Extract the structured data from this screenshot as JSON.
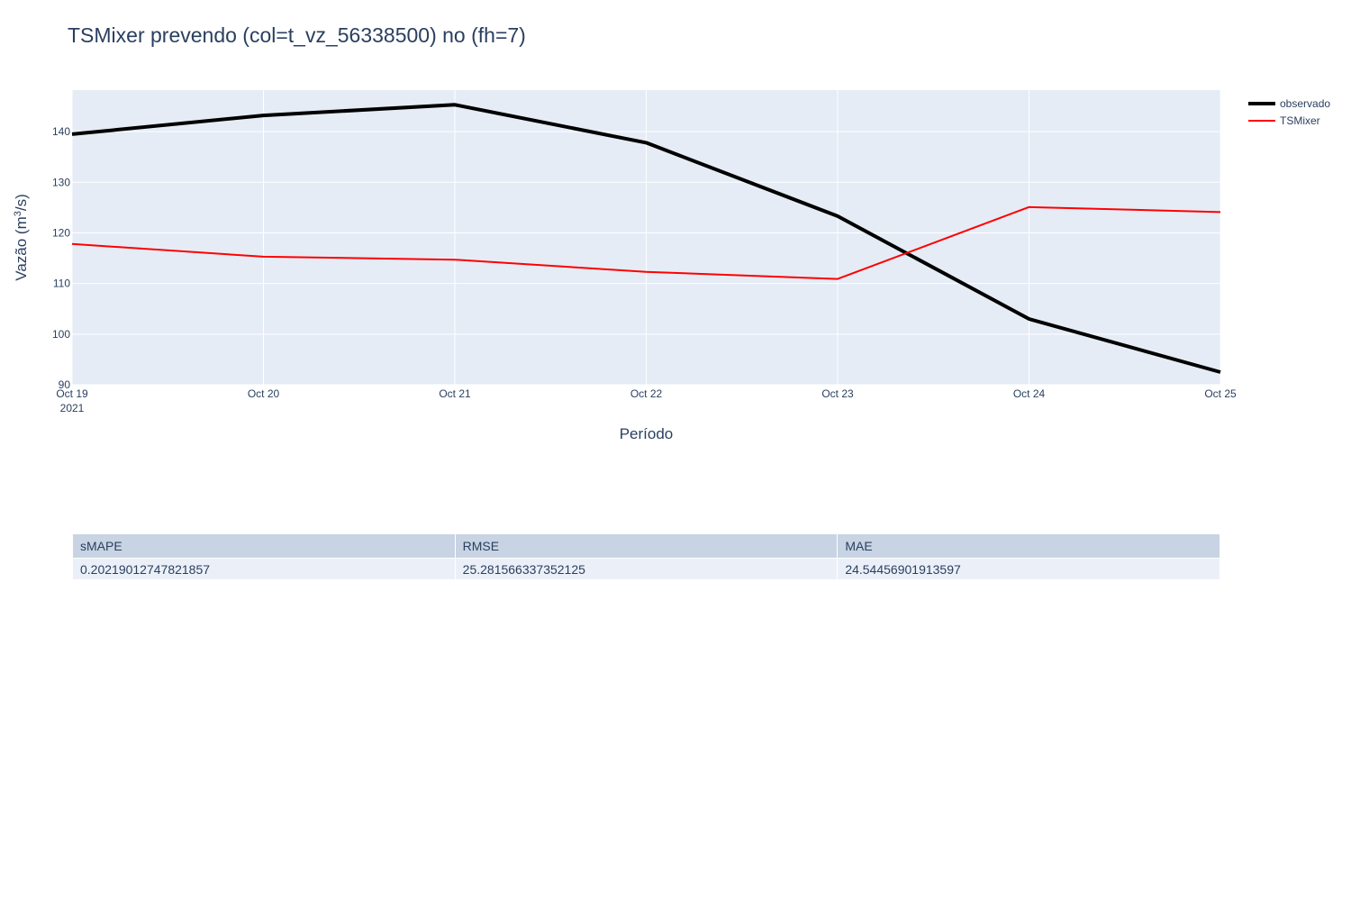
{
  "title": "TSMixer prevendo (col=t_vz_56338500) no (fh=7)",
  "chart_data": {
    "type": "line",
    "title": "TSMixer prevendo (col=t_vz_56338500) no (fh=7)",
    "xlabel": "Período",
    "ylabel_main": "Vazão (m",
    "ylabel_sup": "3",
    "ylabel_tail": "/s)",
    "x": [
      "2021-10-19",
      "2021-10-20",
      "2021-10-21",
      "2021-10-22",
      "2021-10-23",
      "2021-10-24",
      "2021-10-25"
    ],
    "x_tick_labels": [
      "Oct 19",
      "Oct 20",
      "Oct 21",
      "Oct 22",
      "Oct 23",
      "Oct 24",
      "Oct 25"
    ],
    "x_tick_year": "2021",
    "ylim": [
      90,
      148.2
    ],
    "y_ticks": [
      90,
      100,
      110,
      120,
      130,
      140
    ],
    "grid": true,
    "legend_position": "top-right",
    "plot_background": "#e5ecf6",
    "series": [
      {
        "name": "observado",
        "color": "#000000",
        "values": [
          139.5,
          143.2,
          145.3,
          137.8,
          123.3,
          103.0,
          92.5
        ]
      },
      {
        "name": "TSMixer",
        "color": "#ff0000",
        "values": [
          117.8,
          115.3,
          114.7,
          112.3,
          110.9,
          125.1,
          124.1
        ]
      }
    ]
  },
  "metrics_table": {
    "headers": [
      "sMAPE",
      "RMSE",
      "MAE"
    ],
    "rows": [
      [
        "0.20219012747821857",
        "25.281566337352125",
        "24.54456901913597"
      ]
    ]
  }
}
